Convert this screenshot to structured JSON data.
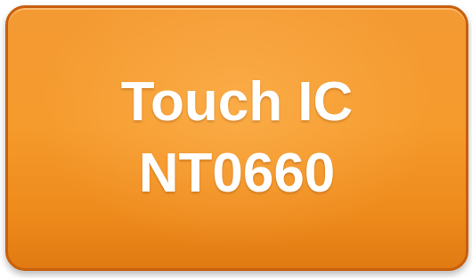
{
  "box": {
    "line1": "Touch IC",
    "line2": "NT0660",
    "fill_color": "#f59a2c",
    "border_color": "#c85f0c",
    "text_color": "#ffffff"
  }
}
